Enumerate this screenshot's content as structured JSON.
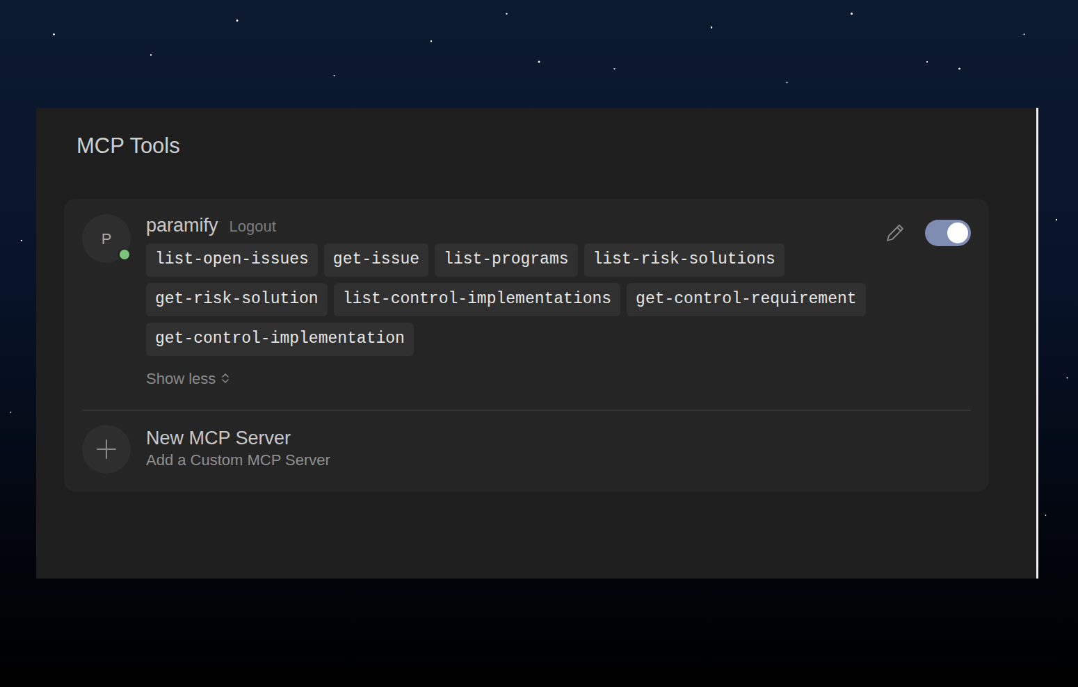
{
  "panel": {
    "title": "MCP Tools"
  },
  "servers": [
    {
      "initial": "P",
      "name": "paramify",
      "action": "Logout",
      "connected": true,
      "enabled": true,
      "tools": [
        "list-open-issues",
        "get-issue",
        "list-programs",
        "list-risk-solutions",
        "get-risk-solution",
        "list-control-implementations",
        "get-control-requirement",
        "get-control-implementation"
      ],
      "toggle_label": "Show less",
      "expanded": true
    }
  ],
  "add_server": {
    "title": "New MCP Server",
    "subtitle": "Add a Custom MCP Server"
  }
}
